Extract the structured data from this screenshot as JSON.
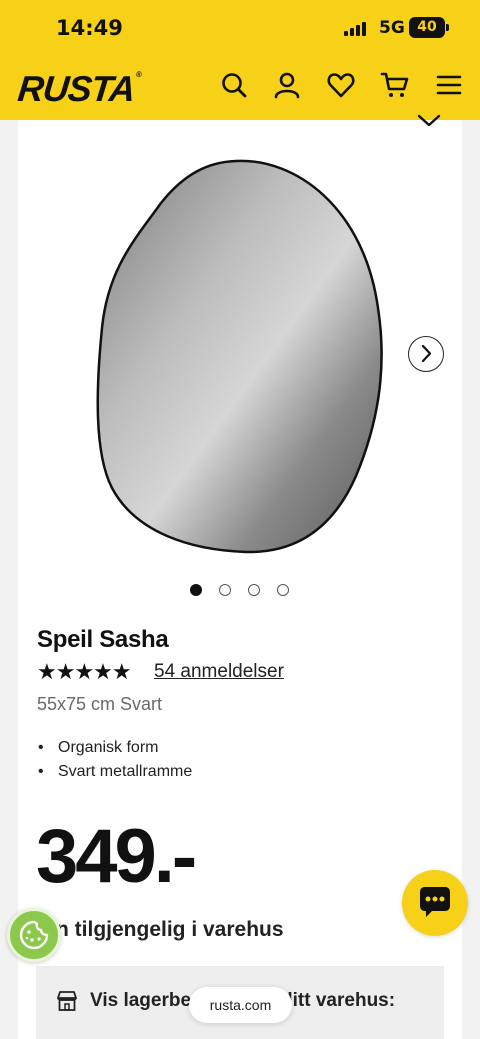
{
  "status_bar": {
    "time": "14:49",
    "network": "5G",
    "battery": "40"
  },
  "header": {
    "logo": "RUSTA",
    "logo_mark": "®",
    "icons": [
      "search-icon",
      "account-icon",
      "heart-icon",
      "cart-icon",
      "menu-icon"
    ]
  },
  "product": {
    "name": "Speil Sasha",
    "rating_stars": "★★★★★",
    "rating": 5,
    "reviews_label": "54 anmeldelser",
    "variant": "55x75 cm Svart",
    "features": [
      "Organisk form",
      "Svart metallramme"
    ],
    "price": "349.-",
    "availability": "n tilgjengelig i varehus",
    "stock_label": "Vis lagerbe",
    "stock_label_end": "ditt varehus:"
  },
  "gallery": {
    "image_count": 4,
    "active_index": 0
  },
  "browser": {
    "url": "rusta.com"
  },
  "colors": {
    "brand_yellow": "#f7d117",
    "cookie_green": "#8cc84b",
    "text": "#111111"
  }
}
